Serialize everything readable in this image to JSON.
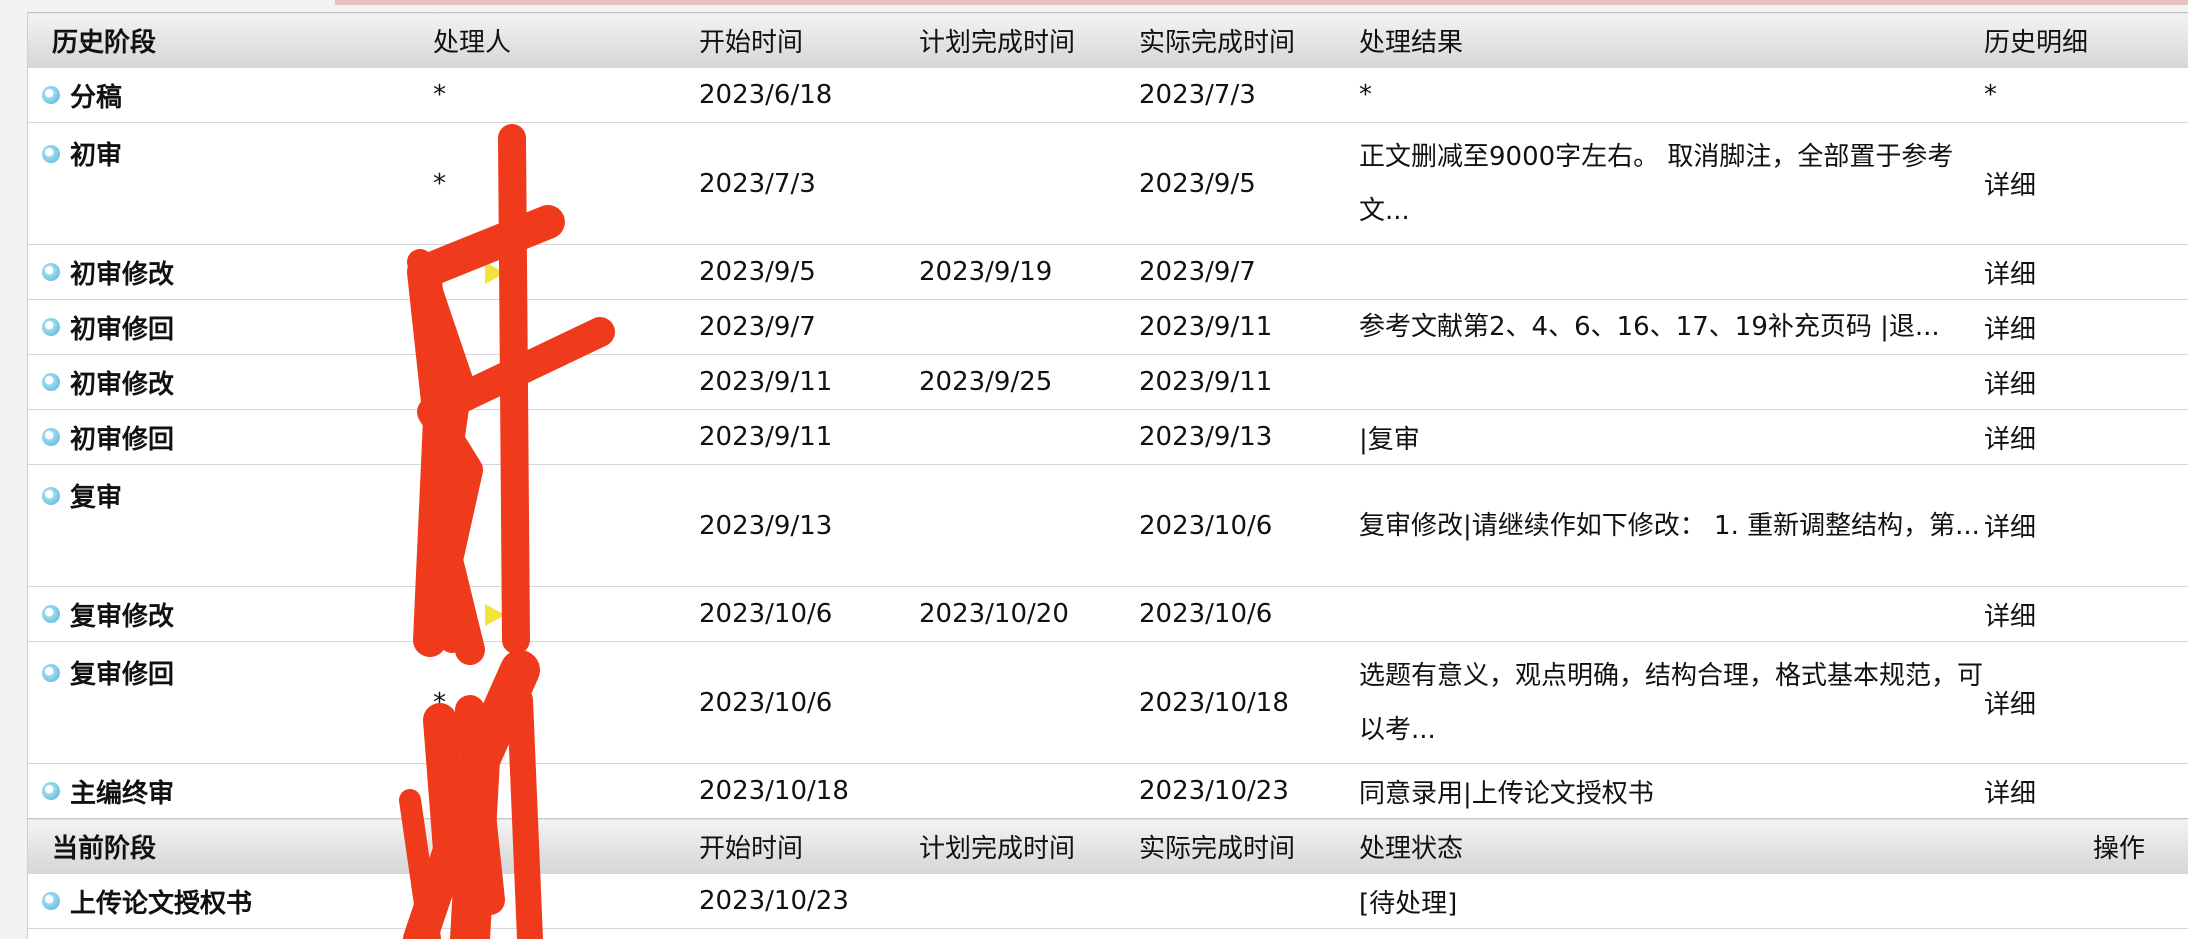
{
  "history_header": {
    "stage": "历史阶段",
    "handler": "处理人",
    "start": "开始时间",
    "planned": "计划完成时间",
    "actual": "实际完成时间",
    "result": "处理结果",
    "detail": "历史明细"
  },
  "history_rows": [
    {
      "stage": "分稿",
      "handler": "*",
      "start": "2023/6/18",
      "planned": "",
      "actual": "2023/7/3",
      "result": "*",
      "detail": "*"
    },
    {
      "stage": "初审",
      "handler": "*",
      "start": "2023/7/3",
      "planned": "",
      "actual": "2023/9/5",
      "result": "正文删减至9000字左右。 取消脚注，全部置于参考文...",
      "detail": "详细"
    },
    {
      "stage": "初审修改",
      "handler": "",
      "start": "2023/9/5",
      "planned": "2023/9/19",
      "actual": "2023/9/7",
      "result": "",
      "detail": "详细"
    },
    {
      "stage": "初审修回",
      "handler": "",
      "start": "2023/9/7",
      "planned": "",
      "actual": "2023/9/11",
      "result": "参考文献第2、4、6、16、17、19补充页码 |退...",
      "detail": "详细"
    },
    {
      "stage": "初审修改",
      "handler": "",
      "start": "2023/9/11",
      "planned": "2023/9/25",
      "actual": "2023/9/11",
      "result": "",
      "detail": "详细"
    },
    {
      "stage": "初审修回",
      "handler": "",
      "start": "2023/9/11",
      "planned": "",
      "actual": "2023/9/13",
      "result": "|复审",
      "detail": "详细"
    },
    {
      "stage": "复审",
      "handler": "",
      "start": "2023/9/13",
      "planned": "",
      "actual": "2023/10/6",
      "result": "复审修改|请继续作如下修改： 1. 重新调整结构，第...",
      "detail": "详细"
    },
    {
      "stage": "复审修改",
      "handler": "",
      "start": "2023/10/6",
      "planned": "2023/10/20",
      "actual": "2023/10/6",
      "result": "",
      "detail": "详细"
    },
    {
      "stage": "复审修回",
      "handler": "*",
      "start": "2023/10/6",
      "planned": "",
      "actual": "2023/10/18",
      "result": "选题有意义，观点明确，结构合理，格式基本规范，可以考...",
      "detail": "详细"
    },
    {
      "stage": "主编终审",
      "handler": "",
      "start": "2023/10/18",
      "planned": "",
      "actual": "2023/10/23",
      "result": "同意录用|上传论文授权书",
      "detail": "详细"
    }
  ],
  "current_header": {
    "stage": "当前阶段",
    "start": "开始时间",
    "planned": "计划完成时间",
    "actual": "实际完成时间",
    "status": "处理状态",
    "operation": "操作"
  },
  "current_rows": [
    {
      "stage": "上传论文授权书",
      "start": "2023/10/23",
      "planned": "",
      "actual": "",
      "status": "[待处理]",
      "operation": ""
    }
  ],
  "colors": {
    "result_link": "#3b7fa8",
    "detail_link": "#2e2ecc",
    "redaction": "#f03a1c",
    "header_bg": "#dcdcdc"
  }
}
